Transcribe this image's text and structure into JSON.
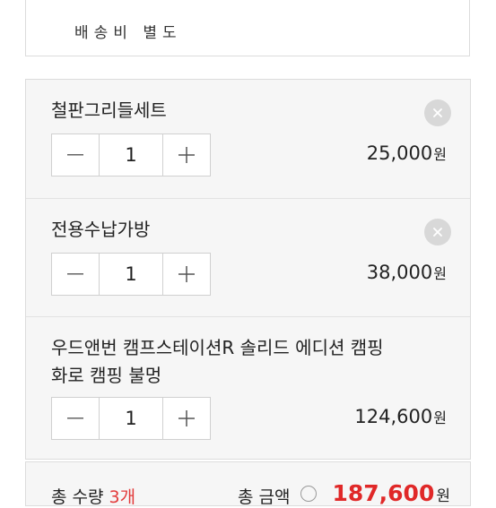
{
  "top_card": {
    "partial_text": "배송비 별도"
  },
  "items": [
    {
      "name": "철판그리들세트",
      "quantity": "1",
      "price": "25,000",
      "currency": "원"
    },
    {
      "name": "전용수납가방",
      "quantity": "1",
      "price": "38,000",
      "currency": "원"
    },
    {
      "name_line1": "우드앤번 캠프스테이션R 솔리드 에디션 캠핑",
      "name_line2": "화로 캠핑 불멍",
      "quantity": "1",
      "price": "124,600",
      "currency": "원"
    }
  ],
  "summary": {
    "count_label": "총 수량",
    "count_value": "3개",
    "total_label": "총 금액",
    "total_value": "187,600",
    "currency": "원"
  },
  "colors": {
    "accent_red": "#e02828",
    "panel_bg": "#f6f6f6",
    "border": "#dcdcdc"
  }
}
